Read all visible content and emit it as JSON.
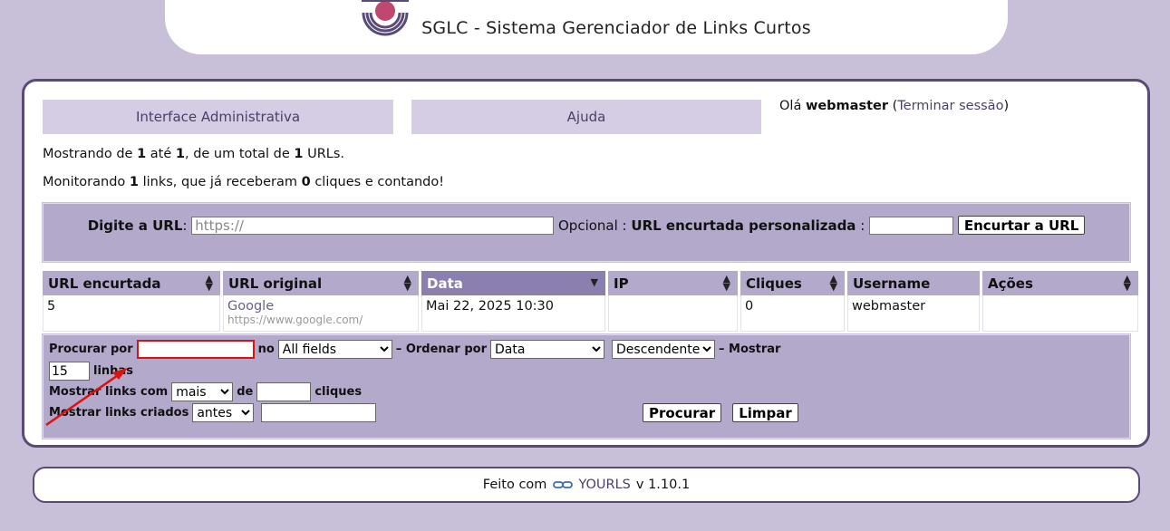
{
  "header": {
    "title": "SGLC - Sistema Gerenciador de Links Curtos",
    "logo_icon": "yourls-logo-icon"
  },
  "nav": {
    "admin_tab": "Interface Administrativa",
    "help_tab": "Ajuda"
  },
  "greeting": {
    "hello": "Olá",
    "user": "webmaster",
    "open_paren": "(",
    "logout": "Terminar sessão",
    "close_paren": ")"
  },
  "stats": {
    "showing_prefix": "Mostrando de",
    "from": "1",
    "to_word": "até",
    "to": "1",
    "total_word": ", de um total de",
    "total": "1",
    "urls_word": "URLs.",
    "monitor_prefix": "Monitorando",
    "links": "1",
    "links_word": "links, que já receberam",
    "clicks": "0",
    "clicks_word": "cliques e contando!"
  },
  "add_url": {
    "label": "Digite a URL",
    "colon": ":",
    "placeholder": "https://",
    "url_value": "",
    "optional": "Opcional :",
    "custom_label": "URL encurtada personalizada",
    "custom_colon": ":",
    "custom_value": "",
    "submit": "Encurtar a URL"
  },
  "table": {
    "columns": [
      "URL encurtada",
      "URL original",
      "Data",
      "IP",
      "Cliques",
      "Username",
      "Ações"
    ],
    "active_column": "Data",
    "rows": [
      {
        "short": "5",
        "title": "Google",
        "url": "https://www.google.com/",
        "date": "Mai 22, 2025 10:30",
        "ip": "",
        "clicks": "0",
        "username": "webmaster",
        "actions": ""
      }
    ]
  },
  "filter": {
    "search_label": "Procurar por",
    "search_value": "",
    "in_label": "no",
    "field_value": "All fields",
    "order_label": "– Ordenar por",
    "order_value": "Data",
    "direction_value": "Descendente",
    "show_label": "– Mostrar",
    "per_page": "15",
    "lines_label": "linhas",
    "clicks_label": "Mostrar links com",
    "clicks_op": "mais",
    "of_label": "de",
    "clicks_value": "",
    "clicks_suffix": "cliques",
    "created_label": "Mostrar links criados",
    "created_op": "antes",
    "created_value": "",
    "search_button": "Procurar",
    "clear_button": "Limpar"
  },
  "footer": {
    "made_with": "Feito com",
    "link_icon": "link-icon",
    "yourls": "YOURLS",
    "version": "v 1.10.1"
  },
  "colors": {
    "background": "#c8c0d9",
    "border": "#594a78",
    "header_bg": "#b3a9cb",
    "active_header": "#8a7fae",
    "highlight": "#e01010"
  }
}
